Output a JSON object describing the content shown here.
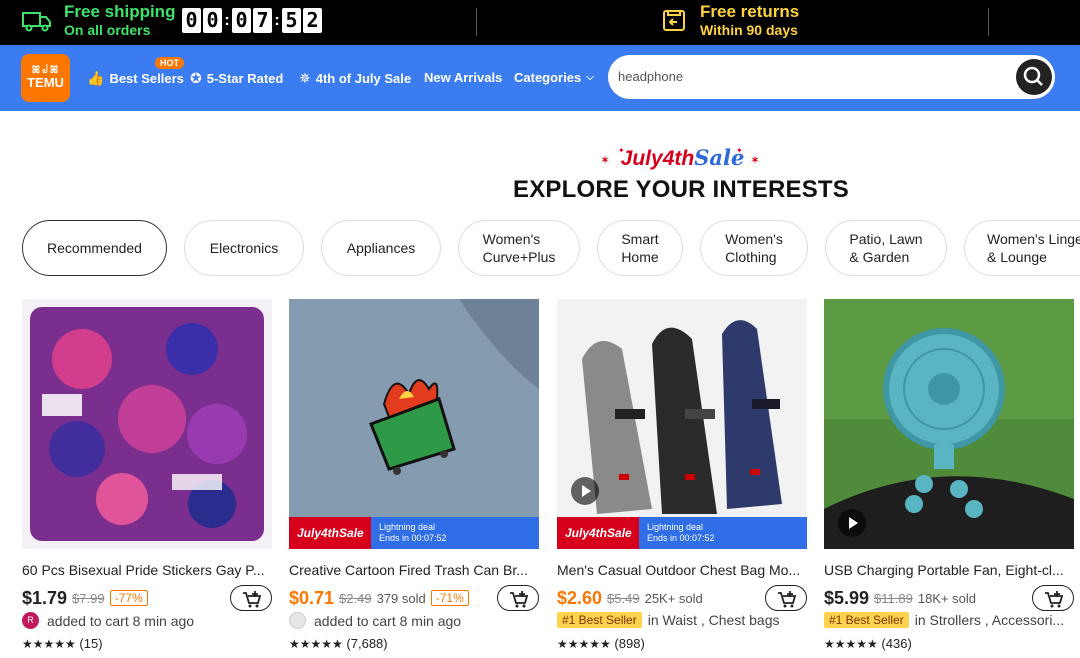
{
  "promo": {
    "shipping_line1": "Free shipping",
    "shipping_line2": "On all orders",
    "timer_digits": [
      "0",
      "0",
      "0",
      "7",
      "5",
      "2"
    ],
    "returns_line1": "Free returns",
    "returns_line2": "Within 90 days"
  },
  "nav": {
    "logo_top": "ꕤ꒻ꕤ",
    "logo_bottom": "TEMU",
    "items": [
      {
        "label": "Best Sellers",
        "icon": "thumbs-up-icon"
      },
      {
        "label": "5-Star Rated",
        "icon": "star-badge-icon"
      },
      {
        "label": "4th of July Sale",
        "icon": "firework-icon"
      },
      {
        "label": "New Arrivals",
        "icon": ""
      },
      {
        "label": "Categories",
        "icon": "chevron-down-icon"
      }
    ],
    "hot_badge": "HOT",
    "search_placeholder": "headphone"
  },
  "hero": {
    "sale_word1": "July4th",
    "sale_word2": "Sale",
    "headline": "EXPLORE YOUR INTERESTS"
  },
  "categories": [
    "Recommended",
    "Electronics",
    "Appliances",
    "Women's\nCurve+Plus",
    "Smart\nHome",
    "Women's\nClothing",
    "Patio, Lawn\n& Garden",
    "Women's Lingerie\n& Lounge"
  ],
  "products": [
    {
      "title": "60 Pcs Bisexual Pride Stickers Gay P...",
      "price": "$1.79",
      "original": "$7.99",
      "sold": "",
      "discount": "-77%",
      "info": "added to cart 8 min ago",
      "avatar_letter": "R",
      "badge": "",
      "rating_count": "(15)"
    },
    {
      "title": "Creative Cartoon Fired Trash Can Br...",
      "price": "$0.71",
      "original": "$2.49",
      "sold": "379 sold",
      "discount": "-71%",
      "info": "added to cart 8 min ago",
      "avatar_letter": "",
      "badge": "",
      "rating_count": "(7,688)",
      "deal_left": "July4thSale",
      "deal_right1": "Lightning deal",
      "deal_right2": "Ends in 00:07:52"
    },
    {
      "title": "Men's Casual Outdoor Chest Bag Mo...",
      "price": "$2.60",
      "original": "$5.49",
      "sold": "25K+ sold",
      "discount": "",
      "info": "in Waist , Chest bags",
      "avatar_letter": "",
      "badge": "#1 Best Seller",
      "rating_count": "(898)",
      "deal_left": "July4thSale",
      "deal_right1": "Lightning deal",
      "deal_right2": "Ends in 00:07:52"
    },
    {
      "title": "USB Charging Portable Fan, Eight-cl...",
      "price": "$5.99",
      "original": "$11.89",
      "sold": "18K+ sold",
      "discount": "",
      "info": "in Strollers , Accessori...",
      "avatar_letter": "",
      "badge": "#1 Best Seller",
      "rating_count": "(436)"
    }
  ],
  "stars": "★★★★★",
  "colors": {
    "nav": "#3b7df0",
    "brand": "#fb7701",
    "sale_red": "#d6001c",
    "green": "#3fe36b",
    "yellow": "#ffd23f"
  }
}
